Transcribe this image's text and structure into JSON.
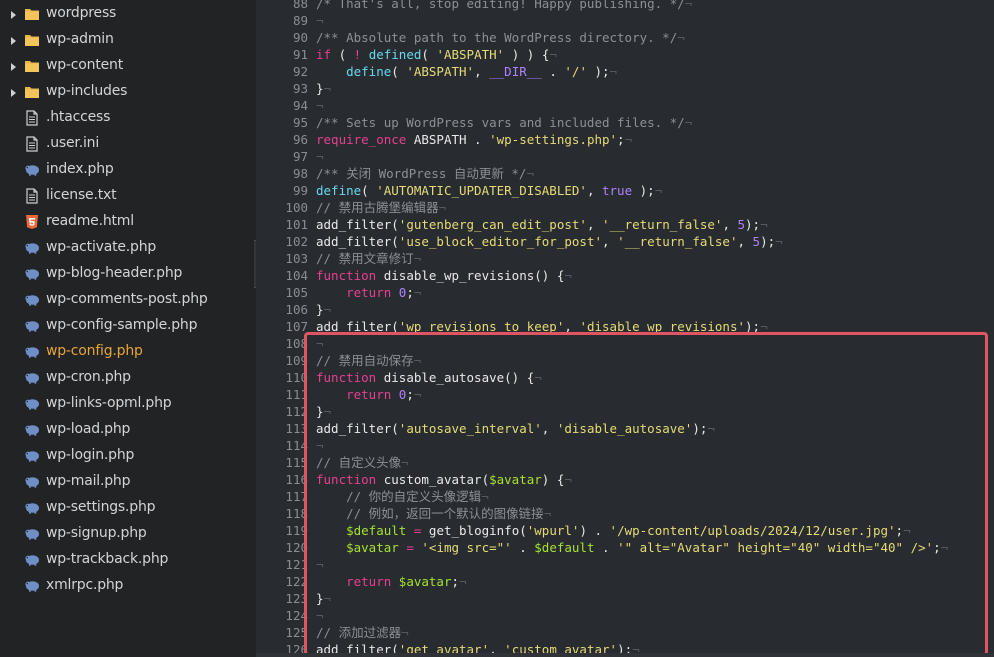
{
  "sidebar": {
    "items": [
      {
        "label": "wordpress",
        "type": "folder",
        "expandable": true
      },
      {
        "label": "wp-admin",
        "type": "folder",
        "expandable": true
      },
      {
        "label": "wp-content",
        "type": "folder",
        "expandable": true
      },
      {
        "label": "wp-includes",
        "type": "folder",
        "expandable": true
      },
      {
        "label": ".htaccess",
        "type": "file"
      },
      {
        "label": ".user.ini",
        "type": "file"
      },
      {
        "label": "index.php",
        "type": "php"
      },
      {
        "label": "license.txt",
        "type": "file"
      },
      {
        "label": "readme.html",
        "type": "html"
      },
      {
        "label": "wp-activate.php",
        "type": "php"
      },
      {
        "label": "wp-blog-header.php",
        "type": "php"
      },
      {
        "label": "wp-comments-post.php",
        "type": "php"
      },
      {
        "label": "wp-config-sample.php",
        "type": "php"
      },
      {
        "label": "wp-config.php",
        "type": "php",
        "active": true
      },
      {
        "label": "wp-cron.php",
        "type": "php"
      },
      {
        "label": "wp-links-opml.php",
        "type": "php"
      },
      {
        "label": "wp-load.php",
        "type": "php"
      },
      {
        "label": "wp-login.php",
        "type": "php"
      },
      {
        "label": "wp-mail.php",
        "type": "php"
      },
      {
        "label": "wp-settings.php",
        "type": "php"
      },
      {
        "label": "wp-signup.php",
        "type": "php"
      },
      {
        "label": "wp-trackback.php",
        "type": "php"
      },
      {
        "label": "xmlrpc.php",
        "type": "php"
      }
    ]
  },
  "colors": {
    "keyword": "#e83f8e",
    "string": "#e6db74",
    "comment": "#8c9096",
    "constant": "#ae81ff",
    "variable": "#a6e22e",
    "text": "#e8e8e8",
    "whitespace": "#555a60",
    "active_file": "#e6a53a",
    "highlight_border": "#e05562"
  },
  "editor": {
    "lines": [
      {
        "n": "88",
        "tokens": [
          [
            "c",
            "/* That's all, stop editing! Happy publishing. */"
          ]
        ]
      },
      {
        "n": "89",
        "tokens": []
      },
      {
        "n": "90",
        "tokens": [
          [
            "c",
            "/** Absolute path to the WordPress directory. */"
          ]
        ]
      },
      {
        "n": "91",
        "tokens": [
          [
            "k",
            "if"
          ],
          [
            "t",
            " ( "
          ],
          [
            "k",
            "!"
          ],
          [
            "t",
            " "
          ],
          [
            "p",
            "defined"
          ],
          [
            "t",
            "( "
          ],
          [
            "s",
            "'ABSPATH'"
          ],
          [
            "t",
            " ) ) {"
          ]
        ]
      },
      {
        "n": "92",
        "tokens": [
          [
            "t",
            "    "
          ],
          [
            "p",
            "define"
          ],
          [
            "t",
            "( "
          ],
          [
            "s",
            "'ABSPATH'"
          ],
          [
            "t",
            ", "
          ],
          [
            "n",
            "__DIR__"
          ],
          [
            "t",
            " . "
          ],
          [
            "s",
            "'/'"
          ],
          [
            "t",
            " );"
          ]
        ]
      },
      {
        "n": "93",
        "tokens": [
          [
            "t",
            "}"
          ]
        ]
      },
      {
        "n": "94",
        "tokens": []
      },
      {
        "n": "95",
        "tokens": [
          [
            "c",
            "/** Sets up WordPress vars and included files. */"
          ]
        ]
      },
      {
        "n": "96",
        "tokens": [
          [
            "k",
            "require_once"
          ],
          [
            "t",
            " ABSPATH . "
          ],
          [
            "s",
            "'wp-settings.php'"
          ],
          [
            "t",
            ";"
          ]
        ]
      },
      {
        "n": "97",
        "tokens": []
      },
      {
        "n": "98",
        "tokens": [
          [
            "c",
            "/** 关闭 WordPress 自动更新 */"
          ]
        ]
      },
      {
        "n": "99",
        "tokens": [
          [
            "p",
            "define"
          ],
          [
            "t",
            "( "
          ],
          [
            "s",
            "'AUTOMATIC_UPDATER_DISABLED'"
          ],
          [
            "t",
            ", "
          ],
          [
            "n",
            "true"
          ],
          [
            "t",
            " );"
          ]
        ]
      },
      {
        "n": "100",
        "tokens": [
          [
            "c",
            "// 禁用古腾堡编辑器"
          ]
        ]
      },
      {
        "n": "101",
        "tokens": [
          [
            "t",
            "add_filter("
          ],
          [
            "s",
            "'gutenberg_can_edit_post'"
          ],
          [
            "t",
            ", "
          ],
          [
            "s",
            "'__return_false'"
          ],
          [
            "t",
            ", "
          ],
          [
            "n",
            "5"
          ],
          [
            "t",
            ");"
          ]
        ]
      },
      {
        "n": "102",
        "tokens": [
          [
            "t",
            "add_filter("
          ],
          [
            "s",
            "'use_block_editor_for_post'"
          ],
          [
            "t",
            ", "
          ],
          [
            "s",
            "'__return_false'"
          ],
          [
            "t",
            ", "
          ],
          [
            "n",
            "5"
          ],
          [
            "t",
            ");"
          ]
        ]
      },
      {
        "n": "103",
        "tokens": [
          [
            "c",
            "// 禁用文章修订"
          ]
        ]
      },
      {
        "n": "104",
        "tokens": [
          [
            "k",
            "function"
          ],
          [
            "t",
            " disable_wp_revisions() {"
          ]
        ]
      },
      {
        "n": "105",
        "tokens": [
          [
            "t",
            "    "
          ],
          [
            "k",
            "return"
          ],
          [
            "t",
            " "
          ],
          [
            "n",
            "0"
          ],
          [
            "t",
            ";"
          ]
        ]
      },
      {
        "n": "106",
        "tokens": [
          [
            "t",
            "}"
          ]
        ]
      },
      {
        "n": "107",
        "tokens": [
          [
            "t",
            "add_filter("
          ],
          [
            "s",
            "'wp_revisions_to_keep'"
          ],
          [
            "t",
            ", "
          ],
          [
            "s",
            "'disable_wp_revisions'"
          ],
          [
            "t",
            ");"
          ]
        ]
      },
      {
        "n": "108",
        "tokens": []
      },
      {
        "n": "109",
        "tokens": [
          [
            "c",
            "// 禁用自动保存"
          ]
        ]
      },
      {
        "n": "110",
        "tokens": [
          [
            "k",
            "function"
          ],
          [
            "t",
            " disable_autosave() {"
          ]
        ]
      },
      {
        "n": "111",
        "tokens": [
          [
            "t",
            "    "
          ],
          [
            "k",
            "return"
          ],
          [
            "t",
            " "
          ],
          [
            "n",
            "0"
          ],
          [
            "t",
            ";"
          ]
        ]
      },
      {
        "n": "112",
        "tokens": [
          [
            "t",
            "}"
          ]
        ]
      },
      {
        "n": "113",
        "tokens": [
          [
            "t",
            "add_filter("
          ],
          [
            "s",
            "'autosave_interval'"
          ],
          [
            "t",
            ", "
          ],
          [
            "s",
            "'disable_autosave'"
          ],
          [
            "t",
            ");"
          ]
        ]
      },
      {
        "n": "114",
        "tokens": []
      },
      {
        "n": "115",
        "tokens": [
          [
            "c",
            "// 自定义头像"
          ]
        ]
      },
      {
        "n": "116",
        "tokens": [
          [
            "k",
            "function"
          ],
          [
            "t",
            " custom_avatar("
          ],
          [
            "v",
            "$avatar"
          ],
          [
            "t",
            ") {"
          ]
        ]
      },
      {
        "n": "117",
        "tokens": [
          [
            "t",
            "    "
          ],
          [
            "c",
            "// 你的自定义头像逻辑"
          ]
        ]
      },
      {
        "n": "118",
        "tokens": [
          [
            "t",
            "    "
          ],
          [
            "c",
            "// 例如，返回一个默认的图像链接"
          ]
        ]
      },
      {
        "n": "119",
        "tokens": [
          [
            "t",
            "    "
          ],
          [
            "v",
            "$default"
          ],
          [
            "t",
            " "
          ],
          [
            "k",
            "="
          ],
          [
            "t",
            " get_bloginfo("
          ],
          [
            "s",
            "'wpurl'"
          ],
          [
            "t",
            ") . "
          ],
          [
            "s",
            "'/wp-content/uploads/2024/12/user.jpg'"
          ],
          [
            "t",
            ";"
          ]
        ]
      },
      {
        "n": "120",
        "tokens": [
          [
            "t",
            "    "
          ],
          [
            "v",
            "$avatar"
          ],
          [
            "t",
            " "
          ],
          [
            "k",
            "="
          ],
          [
            "t",
            " "
          ],
          [
            "s",
            "'<img src=\"'"
          ],
          [
            "t",
            " . "
          ],
          [
            "v",
            "$default"
          ],
          [
            "t",
            " . "
          ],
          [
            "s",
            "'\" alt=\"Avatar\" height=\"40\" width=\"40\" />'"
          ],
          [
            "t",
            ";"
          ]
        ]
      },
      {
        "n": "121",
        "tokens": []
      },
      {
        "n": "122",
        "tokens": [
          [
            "t",
            "    "
          ],
          [
            "k",
            "return"
          ],
          [
            "t",
            " "
          ],
          [
            "v",
            "$avatar"
          ],
          [
            "t",
            ";"
          ]
        ]
      },
      {
        "n": "123",
        "tokens": [
          [
            "t",
            "}"
          ]
        ]
      },
      {
        "n": "124",
        "tokens": []
      },
      {
        "n": "125",
        "tokens": [
          [
            "c",
            "// 添加过滤器"
          ]
        ]
      },
      {
        "n": "126",
        "tokens": [
          [
            "t",
            "add_filter("
          ],
          [
            "s",
            "'get_avatar'"
          ],
          [
            "t",
            ", "
          ],
          [
            "s",
            "'custom_avatar'"
          ],
          [
            "t",
            ");"
          ]
        ]
      }
    ]
  }
}
